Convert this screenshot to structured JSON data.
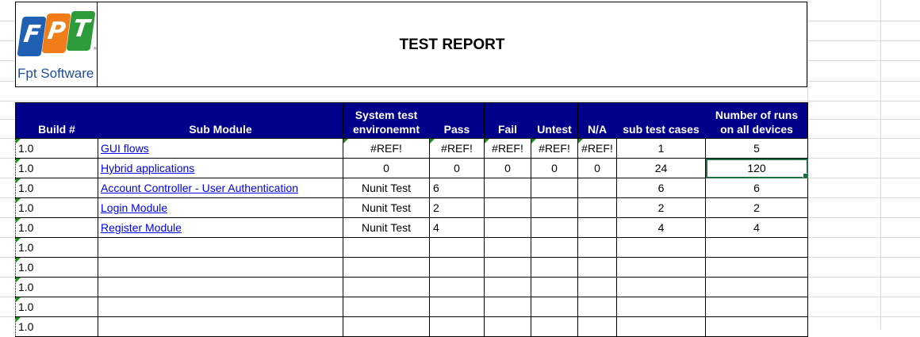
{
  "logo": {
    "letters": [
      "F",
      "P",
      "T"
    ],
    "colors": [
      "#1f5fb4",
      "#f07d1a",
      "#2e9b3a"
    ],
    "registered": "®",
    "company": "Fpt Software"
  },
  "report": {
    "title": "TEST REPORT"
  },
  "table": {
    "headers": {
      "build": "Build #",
      "sub_module": "Sub Module",
      "environment": "System test environemnt",
      "pass": "Pass",
      "fail": "Fail",
      "untest": "Untest",
      "na": "N/A",
      "sub_test_cases": "sub test cases",
      "runs": "Number of  runs on all devices"
    },
    "rows": [
      {
        "build": "1.0",
        "module": "GUI flows",
        "env": "#REF!",
        "pass": "#REF!",
        "fail": "#REF!",
        "untest": "#REF!",
        "na": "#REF!",
        "cases": "1",
        "runs": "5"
      },
      {
        "build": "1.0",
        "module": "Hybrid applications",
        "env": "0",
        "pass": "0",
        "fail": "0",
        "untest": "0",
        "na": "0",
        "cases": "24",
        "runs": "120"
      },
      {
        "build": "1.0",
        "module": "Account Controller - User Authentication",
        "env": "Nunit Test",
        "pass": "6",
        "fail": "",
        "untest": "",
        "na": "",
        "cases": "6",
        "runs": "6"
      },
      {
        "build": "1.0",
        "module": "Login Module",
        "env": "Nunit Test",
        "pass": "2",
        "fail": "",
        "untest": "",
        "na": "",
        "cases": "2",
        "runs": "2"
      },
      {
        "build": "1.0",
        "module": "Register Module",
        "env": "Nunit Test",
        "pass": "4",
        "fail": "",
        "untest": "",
        "na": "",
        "cases": "4",
        "runs": "4"
      },
      {
        "build": "1.0",
        "module": "",
        "env": "",
        "pass": "",
        "fail": "",
        "untest": "",
        "na": "",
        "cases": "",
        "runs": ""
      },
      {
        "build": "1.0",
        "module": "",
        "env": "",
        "pass": "",
        "fail": "",
        "untest": "",
        "na": "",
        "cases": "",
        "runs": ""
      },
      {
        "build": "1.0",
        "module": "",
        "env": "",
        "pass": "",
        "fail": "",
        "untest": "",
        "na": "",
        "cases": "",
        "runs": ""
      },
      {
        "build": "1.0",
        "module": "",
        "env": "",
        "pass": "",
        "fail": "",
        "untest": "",
        "na": "",
        "cases": "",
        "runs": ""
      },
      {
        "build": "1.0",
        "module": "",
        "env": "",
        "pass": "",
        "fail": "",
        "untest": "",
        "na": "",
        "cases": "",
        "runs": ""
      }
    ]
  },
  "colors": {
    "header_bg": "#00008b",
    "link": "#0000ee",
    "selection": "#1e7145"
  }
}
